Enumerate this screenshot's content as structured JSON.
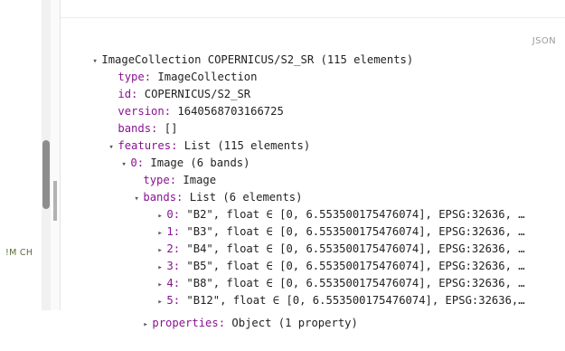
{
  "left": {
    "label": "!M CH"
  },
  "tree": {
    "root_label": "ImageCollection COPERNICUS/S2_SR (115 elements)",
    "json_button": "JSON",
    "props": [
      {
        "key": "type",
        "value": "ImageCollection"
      },
      {
        "key": "id",
        "value": "COPERNICUS/S2_SR"
      },
      {
        "key": "version",
        "value": "1640568703166725"
      },
      {
        "key": "bands",
        "value": "[]"
      }
    ],
    "features": {
      "key": "features",
      "value": "List (115 elements)"
    },
    "image0": {
      "key": "0",
      "value": "Image (6 bands)"
    },
    "image0_type": {
      "key": "type",
      "value": "Image"
    },
    "image0_bands": {
      "key": "bands",
      "value": "List (6 elements)"
    },
    "band_items": [
      {
        "index": "0",
        "text": "\"B2\", float ∈ [0, 6.553500175476074], EPSG:32636, …"
      },
      {
        "index": "1",
        "text": "\"B3\", float ∈ [0, 6.553500175476074], EPSG:32636, …"
      },
      {
        "index": "2",
        "text": "\"B4\", float ∈ [0, 6.553500175476074], EPSG:32636, …"
      },
      {
        "index": "3",
        "text": "\"B5\", float ∈ [0, 6.553500175476074], EPSG:32636, …"
      },
      {
        "index": "4",
        "text": "\"B8\", float ∈ [0, 6.553500175476074], EPSG:32636, …"
      },
      {
        "index": "5",
        "text": "\"B12\", float ∈ [0, 6.553500175476074], EPSG:32636,…"
      }
    ],
    "properties": {
      "key": "properties",
      "value": "Object (1 property)"
    }
  }
}
